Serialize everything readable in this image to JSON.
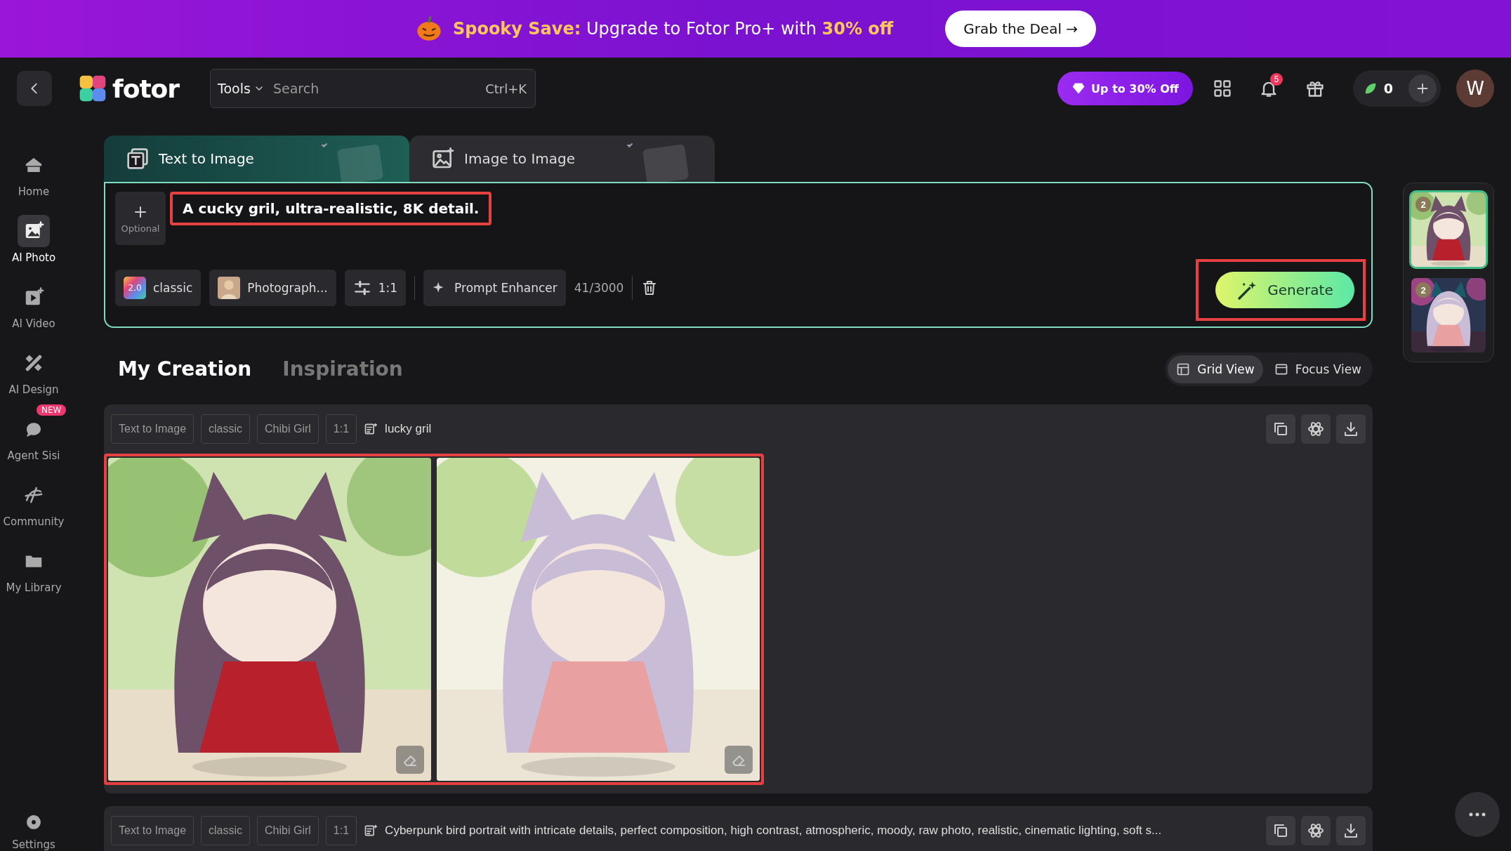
{
  "banner": {
    "text": "**Spooky Save:** Upgrade to Fotor Pro+ with **30% off**",
    "button": "Grab the Deal →"
  },
  "header": {
    "logo": "fotor",
    "tools": "Tools",
    "search": {
      "placeholder": "Search"
    },
    "shortcut": "Ctrl+K",
    "promo": "Up to 30% Off",
    "notifications": "5",
    "credits": "0",
    "avatar": "W"
  },
  "sidebar": {
    "items": [
      {
        "label": "Home",
        "selected": false
      },
      {
        "label": "AI Photo",
        "selected": true
      },
      {
        "label": "AI Video",
        "selected": false
      },
      {
        "label": "AI Design",
        "selected": false
      },
      {
        "label": "Agent Sisi",
        "selected": false,
        "badge": "NEW"
      },
      {
        "label": "Community",
        "selected": false
      },
      {
        "label": "My Library",
        "selected": false
      }
    ],
    "settings": "Settings"
  },
  "creator": {
    "tabs": [
      {
        "label": "Text to Image",
        "selected": true
      },
      {
        "label": "Image to Image",
        "selected": false
      }
    ],
    "optional": "Optional",
    "prompt": {
      "value": "A cucky gril, ultra-realistic, 8K detail.",
      "highlighted": true
    },
    "options": [
      {
        "kind": "model",
        "badge": "2.0",
        "label": "classic"
      },
      {
        "kind": "style",
        "label": "Photograph..."
      },
      {
        "kind": "ratio",
        "label": "1:1"
      },
      {
        "kind": "enhancer",
        "label": "Prompt Enhancer"
      }
    ],
    "counter": "41/3000",
    "generate": {
      "label": "Generate",
      "highlighted": true
    }
  },
  "section_tabs": [
    {
      "label": "My Creation",
      "selected": true
    },
    {
      "label": "Inspiration",
      "selected": false
    }
  ],
  "views": [
    {
      "label": "Grid View",
      "selected": true
    },
    {
      "label": "Focus View",
      "selected": false
    }
  ],
  "creations": [
    {
      "tags": [
        "Text to Image",
        "classic",
        "Chibi Girl",
        "1:1"
      ],
      "prompt": "lucky gril",
      "highlighted": true
    },
    {
      "tags": [
        "Text to Image",
        "classic",
        "Chibi Girl",
        "1:1"
      ],
      "prompt": "Cyberpunk bird portrait with intricate details, perfect composition, high contrast, atmospheric, moody, raw photo, realistic, cinematic lighting, soft s..."
    }
  ],
  "history": [
    {
      "count": "2",
      "selected": true
    },
    {
      "count": "2",
      "selected": false
    }
  ]
}
